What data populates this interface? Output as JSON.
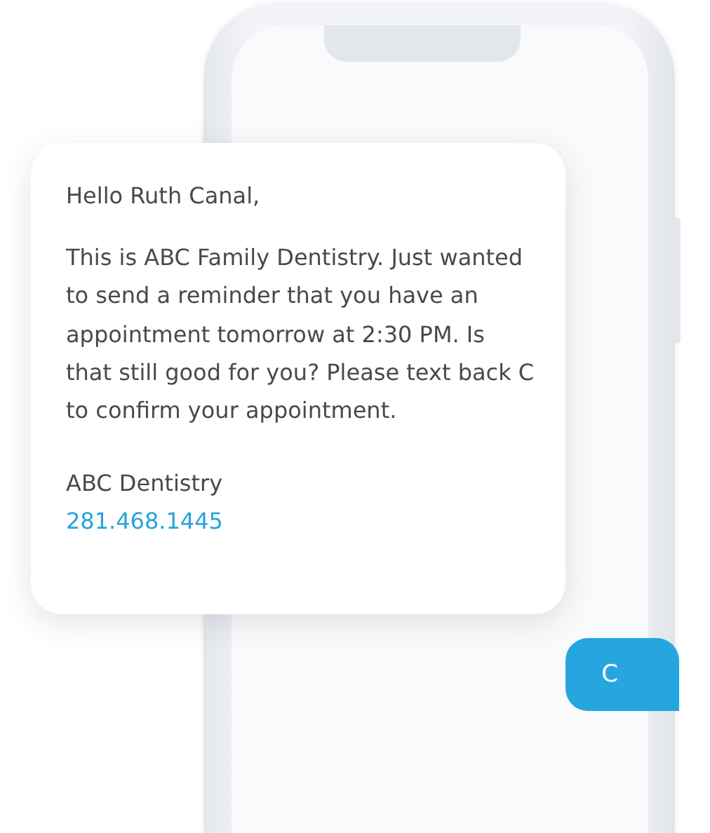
{
  "message": {
    "greeting": "Hello Ruth Canal,",
    "body": "This is ABC Family Dentistry. Just wanted to send a reminder that you have an appointment tomorrow at 2:30 PM. Is that still good for you? Please text back C to confirm your appointment.",
    "signature": "ABC Dentistry",
    "phone": "281.468.1445"
  },
  "reply": {
    "text": "C"
  }
}
